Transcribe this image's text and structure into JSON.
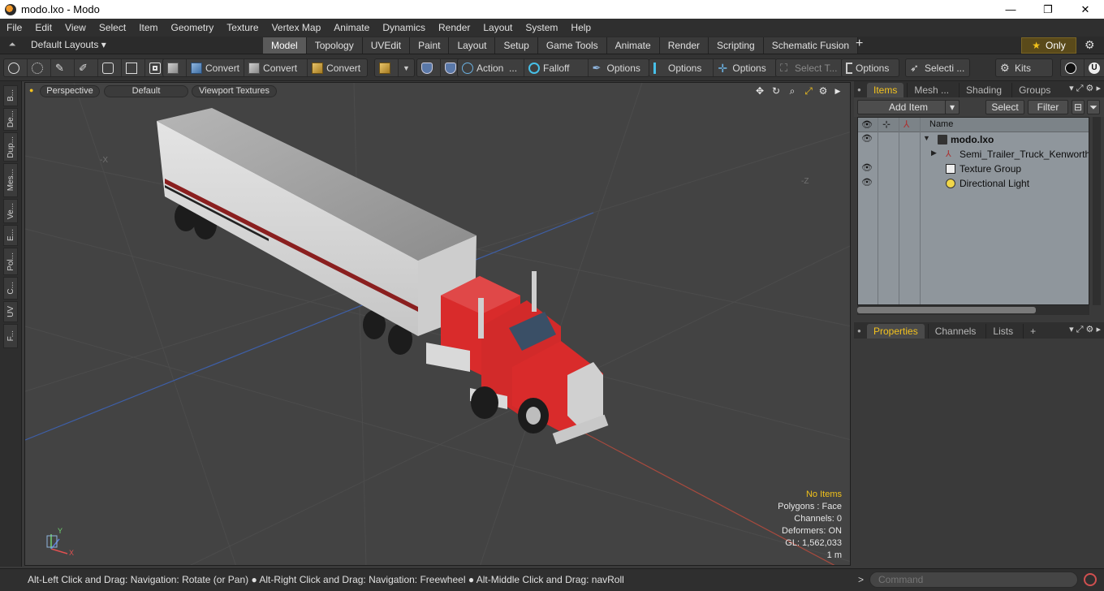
{
  "window": {
    "title": "modo.lxo - Modo",
    "minimize": "—",
    "maximize": "❐",
    "close": "✕"
  },
  "menubar": [
    "File",
    "Edit",
    "View",
    "Select",
    "Item",
    "Geometry",
    "Texture",
    "Vertex Map",
    "Animate",
    "Dynamics",
    "Render",
    "Layout",
    "System",
    "Help"
  ],
  "layoutbar": {
    "layouts_dropdown": "Default Layouts ▾",
    "tabs": [
      "Model",
      "Topology",
      "UVEdit",
      "Paint",
      "Layout",
      "Setup",
      "Game Tools",
      "Animate",
      "Render",
      "Scripting",
      "Schematic Fusion"
    ],
    "active_tab": "Model",
    "add_tab": "+",
    "only_label": "Only"
  },
  "toolbar": {
    "convert_1": "Convert",
    "convert_2": "Convert",
    "convert_3": "Convert",
    "action": "Action",
    "action_more": "...",
    "falloff": "Falloff",
    "options_1": "Options",
    "options_2": "Options",
    "options_3": "Options",
    "select_t": "Select T...",
    "options_4": "Options",
    "selecti": "Selecti ...",
    "kits": "Kits"
  },
  "lefttabs": [
    "B...",
    "De...",
    "Dup...",
    "Mes...",
    "Ve...",
    "E...",
    "Pol...",
    "C...",
    "UV",
    "F..."
  ],
  "viewport": {
    "view_mode": "Perspective",
    "shading": "Default",
    "textures": "Viewport Textures",
    "axis_x_neg": "-X",
    "axis_z_neg": "-Z",
    "stats": {
      "no_items": "No Items",
      "polygons": "Polygons : Face",
      "channels": "Channels: 0",
      "deformers": "Deformers: ON",
      "gl": "GL: 1,562,033",
      "unit": "1 m"
    },
    "gizmo_y": "Y",
    "gizmo_x": "X"
  },
  "statusbar": {
    "hint": "Alt-Left Click and Drag: Navigation: Rotate (or Pan) ● Alt-Right Click and Drag: Navigation: Freewheel ● Alt-Middle Click and Drag: navRoll",
    "prompt": ">",
    "command_placeholder": "Command"
  },
  "items_panel": {
    "tabs": [
      "Items",
      "Mesh ...",
      "Shading",
      "Groups"
    ],
    "active_tab": "Items",
    "add_item": "Add Item",
    "select": "Select",
    "filter": "Filter",
    "column_name": "Name",
    "tree": [
      {
        "label": "modo.lxo",
        "bold": true,
        "eye": true
      },
      {
        "label": "Semi_Trailer_Truck_Kenworth ...",
        "bold": false,
        "eye": false
      },
      {
        "label": "Texture Group",
        "bold": false,
        "eye": true
      },
      {
        "label": "Directional Light",
        "bold": false,
        "eye": true
      }
    ]
  },
  "props_panel": {
    "tabs": [
      "Properties",
      "Channels",
      "Lists"
    ],
    "active_tab": "Properties",
    "add_tab": "+"
  },
  "colors": {
    "accent_yellow": "#f3c21e",
    "truck_red": "#d92b2b",
    "viewport_bg": "#434343",
    "tree_bg": "#8f969c"
  }
}
